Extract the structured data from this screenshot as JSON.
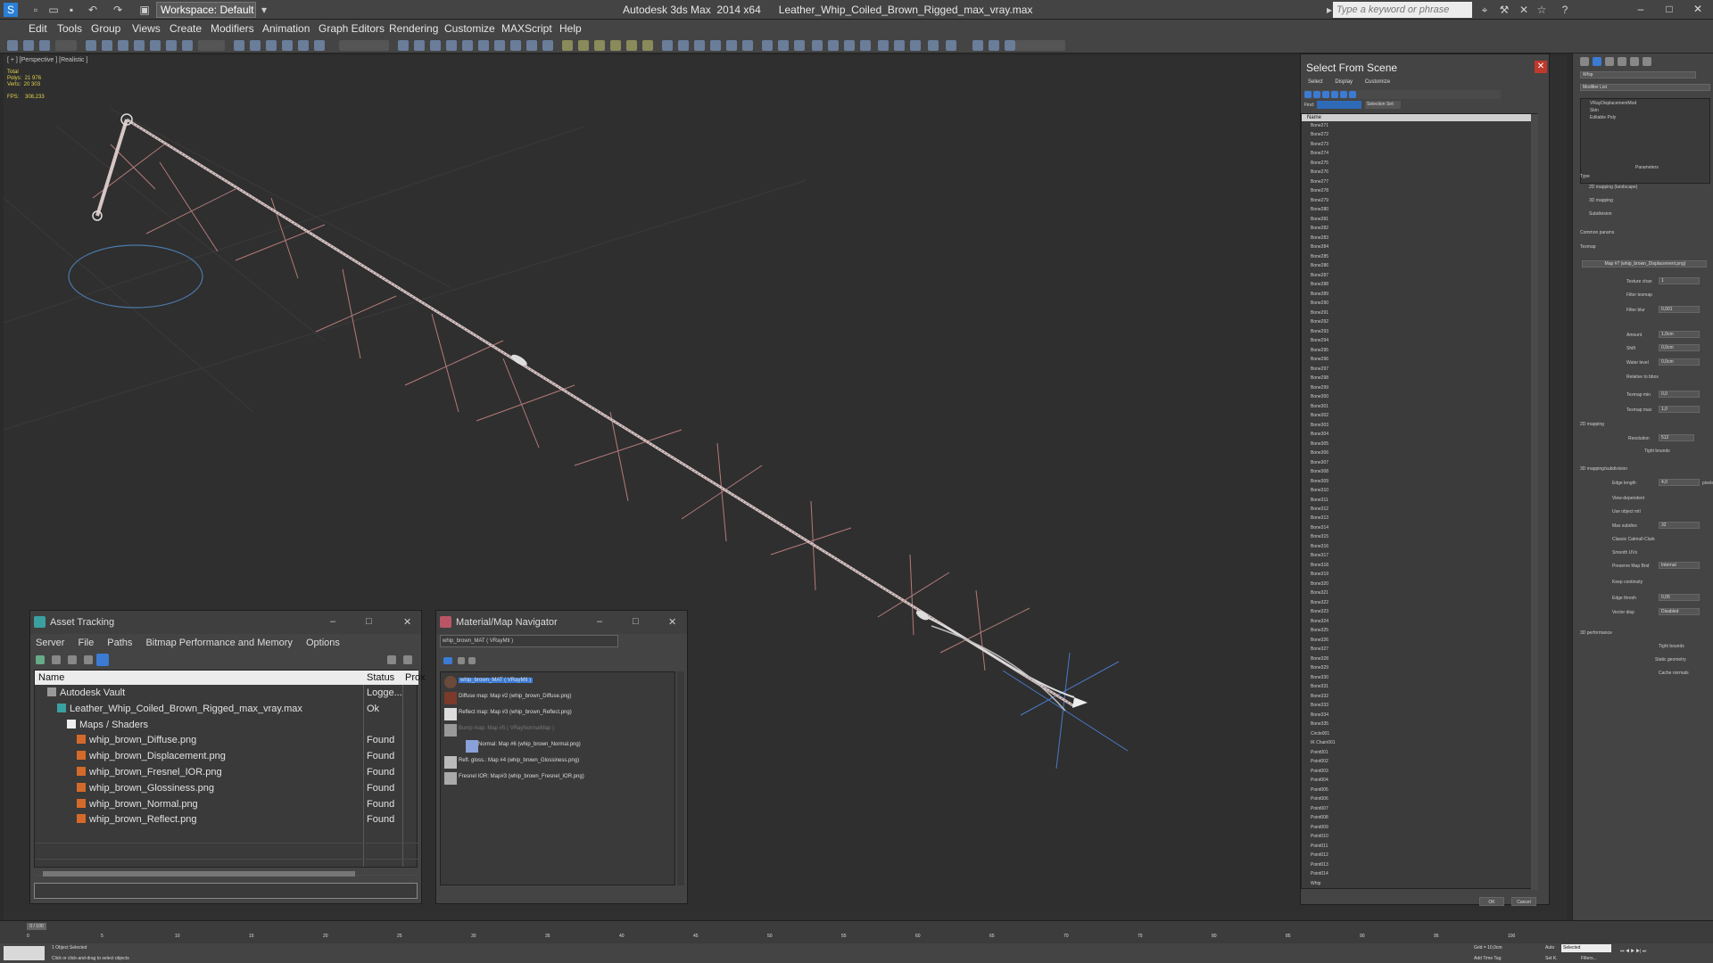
{
  "window": {
    "app_title": "Autodesk 3ds Max  2014 x64",
    "file_title": "Leather_Whip_Coiled_Brown_Rigged_max_vray.max",
    "workspace": "Workspace: Default",
    "search_placeholder": "Type a keyword or phrase"
  },
  "menu": [
    "Edit",
    "Tools",
    "Group",
    "Views",
    "Create",
    "Modifiers",
    "Animation",
    "Graph Editors",
    "Rendering",
    "Customize",
    "MAXScript",
    "Help"
  ],
  "viewport": {
    "label": "[ + ] [Perspective ] [Realistic ]",
    "stats": "Total\nPolys:  21 976\nVerts:  20 303\n\nFPS:    308,233"
  },
  "asset_tracking": {
    "title": "Asset Tracking",
    "menu": [
      "Server",
      "File",
      "Paths",
      "Bitmap Performance and Memory",
      "Options"
    ],
    "columns": {
      "name": "Name",
      "status": "Status",
      "proxy": "Prox"
    },
    "rows": [
      {
        "name": "Autodesk Vault",
        "status": "Logge...",
        "indent": 0
      },
      {
        "name": "Leather_Whip_Coiled_Brown_Rigged_max_vray.max",
        "status": "Ok",
        "indent": 1
      },
      {
        "name": "Maps / Shaders",
        "status": "",
        "indent": 2
      },
      {
        "name": "whip_brown_Diffuse.png",
        "status": "Found",
        "indent": 3
      },
      {
        "name": "whip_brown_Displacement.png",
        "status": "Found",
        "indent": 3
      },
      {
        "name": "whip_brown_Fresnel_IOR.png",
        "status": "Found",
        "indent": 3
      },
      {
        "name": "whip_brown_Glossiness.png",
        "status": "Found",
        "indent": 3
      },
      {
        "name": "whip_brown_Normal.png",
        "status": "Found",
        "indent": 3
      },
      {
        "name": "whip_brown_Reflect.png",
        "status": "Found",
        "indent": 3
      }
    ]
  },
  "material_navigator": {
    "title": "Material/Map Navigator",
    "field": "whip_brown_MAT  ( VRayMtl )",
    "nodes": [
      {
        "label": "whip_brown_MAT  ( VRayMtl )",
        "selected": true
      },
      {
        "label": "Diffuse map: Map #2 (whip_brown_Diffuse.png)"
      },
      {
        "label": "Reflect map: Map #3 (whip_brown_Reflect.png)"
      },
      {
        "label": "Bump map: Map #5 ( VRayNormalMap )",
        "dim": true
      },
      {
        "label": "Normal: Map #6 (whip_brown_Normal.png)"
      },
      {
        "label": "Refl. gloss.: Map #4 (whip_brown_Glossiness.png)"
      },
      {
        "label": "Fresnel IOR: Map#3 (whip_brown_Fresnel_IOR.png)"
      }
    ]
  },
  "select_from_scene": {
    "title": "Select From Scene",
    "menu": [
      "Select",
      "Display",
      "Customize"
    ],
    "find_label": "Find:",
    "selection_set": "Selection Set:",
    "column": "Name",
    "items": [
      "Bone271",
      "Bone272",
      "Bone273",
      "Bone274",
      "Bone275",
      "Bone276",
      "Bone277",
      "Bone278",
      "Bone279",
      "Bone280",
      "Bone281",
      "Bone282",
      "Bone283",
      "Bone284",
      "Bone285",
      "Bone286",
      "Bone287",
      "Bone288",
      "Bone289",
      "Bone290",
      "Bone291",
      "Bone292",
      "Bone293",
      "Bone294",
      "Bone295",
      "Bone296",
      "Bone297",
      "Bone298",
      "Bone299",
      "Bone300",
      "Bone301",
      "Bone302",
      "Bone303",
      "Bone304",
      "Bone305",
      "Bone306",
      "Bone307",
      "Bone308",
      "Bone309",
      "Bone310",
      "Bone311",
      "Bone312",
      "Bone313",
      "Bone314",
      "Bone315",
      "Bone316",
      "Bone317",
      "Bone318",
      "Bone319",
      "Bone320",
      "Bone321",
      "Bone322",
      "Bone323",
      "Bone324",
      "Bone325",
      "Bone326",
      "Bone327",
      "Bone328",
      "Bone329",
      "Bone330",
      "Bone331",
      "Bone332",
      "Bone333",
      "Bone334",
      "Bone335",
      "Circle001",
      "IK Chain001",
      "Point001",
      "Point002",
      "Point003",
      "Point004",
      "Point005",
      "Point006",
      "Point007",
      "Point008",
      "Point009",
      "Point010",
      "Point011",
      "Point012",
      "Point013",
      "Point014",
      "Whip"
    ],
    "ok": "OK",
    "cancel": "Cancel"
  },
  "command_panel": {
    "object_name": "Whip",
    "modifier_list": "Modifier List",
    "stack": [
      "VRayDisplacementMod",
      "Skin",
      "Editable Poly"
    ],
    "rollout": "Parameters",
    "type_label": "Type",
    "type_options": [
      "2D mapping (landscape)",
      "3D mapping",
      "Subdivision"
    ],
    "common_params": "Common params",
    "texmap_label": "Texmap",
    "texmap_value": "Map #7 (whip_brown_Displacement.png)",
    "fields": [
      {
        "label": "Texture chan",
        "value": "1"
      },
      {
        "label": "Filter texmap",
        "value": ""
      },
      {
        "label": "Filter blur",
        "value": "0,001"
      },
      {
        "label": "Amount",
        "value": "1,0cm"
      },
      {
        "label": "Shift",
        "value": "0,0cm"
      },
      {
        "label": "Water level",
        "value": "0,0cm"
      },
      {
        "label": "Relative to bbox",
        "value": ""
      },
      {
        "label": "Texmap min",
        "value": "0,0"
      },
      {
        "label": "Texmap max",
        "value": "1,0"
      }
    ],
    "mapping_2d": "2D mapping",
    "resolution_label": "Resolution",
    "resolution_value": "512",
    "tight_bounds": "Tight bounds",
    "subdivision_title": "3D mapping/subdivision",
    "sub_fields": [
      {
        "label": "Edge length",
        "value": "4,0",
        "unit": "pixels"
      },
      {
        "label": "View-dependent",
        "value": ""
      },
      {
        "label": "Use object mtl",
        "value": ""
      },
      {
        "label": "Max subdivs",
        "value": "32"
      },
      {
        "label": "Classic Catmull-Clark",
        "value": ""
      },
      {
        "label": "Smooth UVs",
        "value": ""
      },
      {
        "label": "Preserve Map Bnd",
        "value": "Internal"
      },
      {
        "label": "Keep continuity",
        "value": ""
      },
      {
        "label": "Edge thresh",
        "value": "0,05"
      },
      {
        "label": "Vector disp",
        "value": "Disabled"
      }
    ],
    "performance_title": "3D performance",
    "perf_fields": [
      "Tight bounds",
      "Static geometry",
      "Cache normals"
    ]
  },
  "timeline": {
    "frame_label": "0 / 100",
    "ticks": [
      "0",
      "5",
      "10",
      "15",
      "20",
      "25",
      "30",
      "35",
      "40",
      "45",
      "50",
      "55",
      "60",
      "65",
      "70",
      "75",
      "80",
      "85",
      "90",
      "95",
      "100"
    ]
  },
  "status": {
    "selected": "1 Object Selected",
    "prompt": "Click or click-and-drag to select objects",
    "grid": "Grid = 10,0cm",
    "auto": "Auto",
    "selected_dropdown": "Selected",
    "add_time_tag": "Add Time Tag",
    "set_k": "Set K.",
    "filters": "Filters..."
  }
}
